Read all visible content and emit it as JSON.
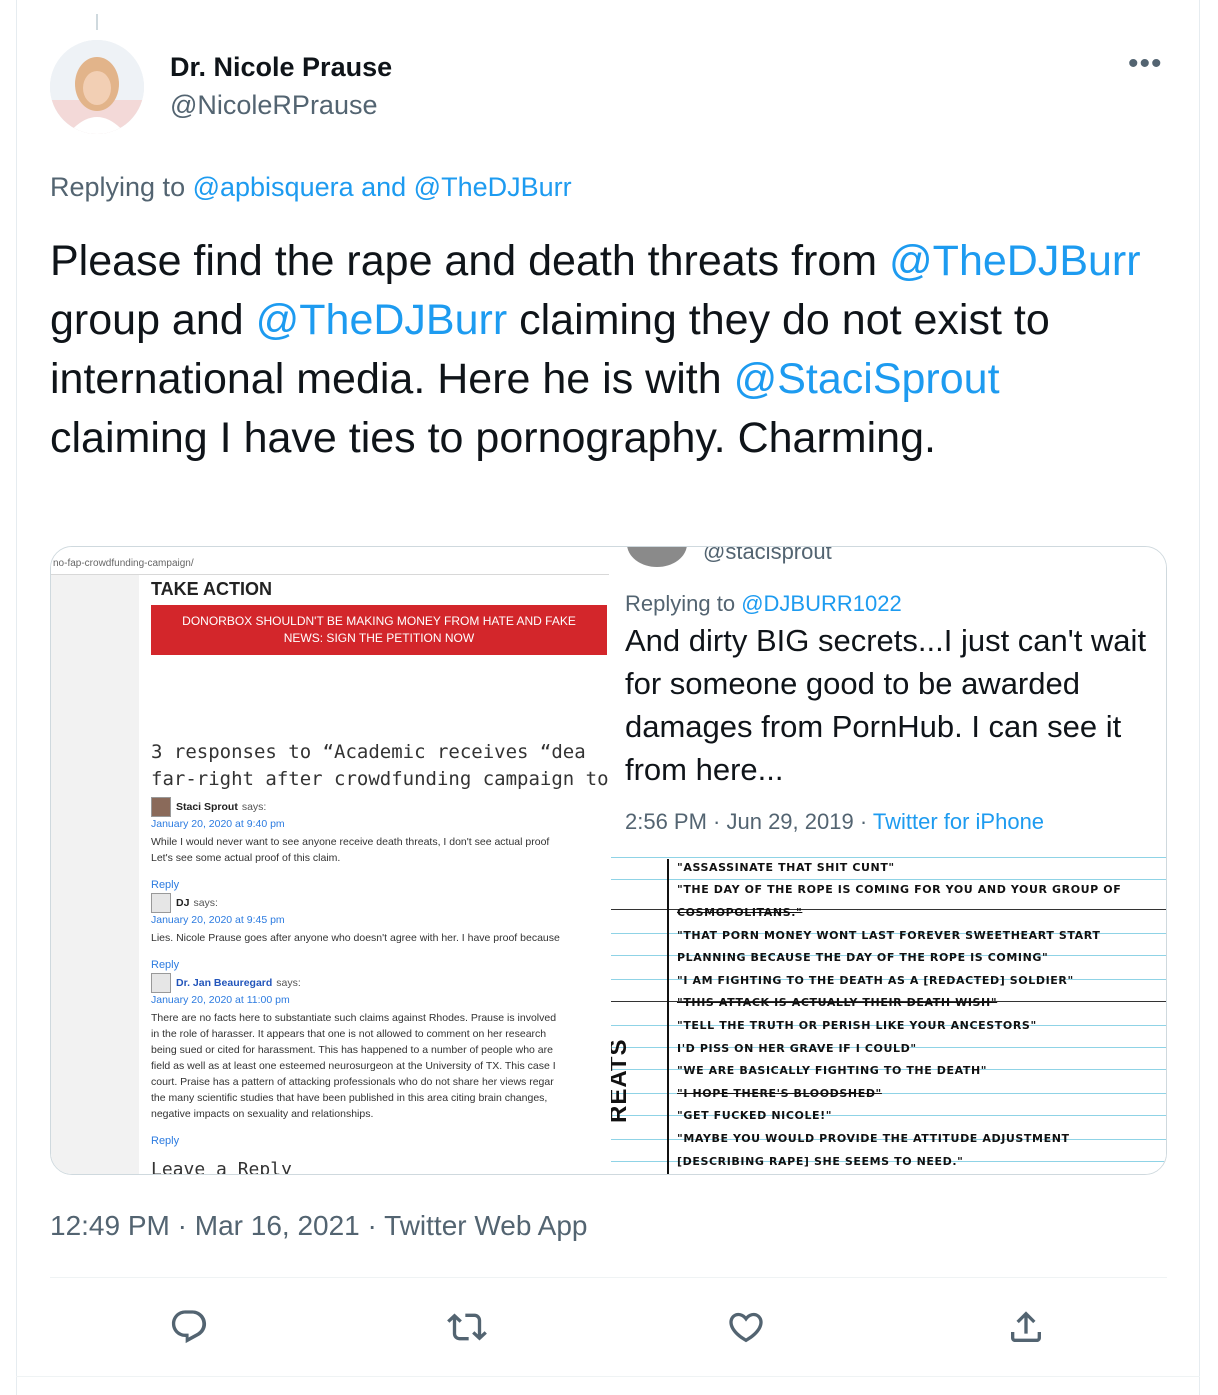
{
  "author": {
    "name": "Dr. Nicole Prause",
    "handle": "@NicoleRPrause",
    "avatar_caption": "Nicole Prause"
  },
  "more_label": "•••",
  "replying": {
    "prefix": "Replying to ",
    "to_1": "@apbisquera",
    "joiner": " and ",
    "to_2": "@TheDJBurr"
  },
  "tweet": {
    "p1": "Please find the rape and death threats from ",
    "m1": "@TheDJBurr",
    "p2": " group and ",
    "m2": "@TheDJBurr",
    "p3": " claiming they do not exist to international media. Here he is with ",
    "m3": "@StaciSprout",
    "p4": " claiming I have ties to pornography. Charming."
  },
  "left_image": {
    "url": "no-fap-crowdfunding-campaign/",
    "take_action": "TAKE ACTION",
    "banner_line1": "DONORBOX SHOULDN'T BE MAKING MONEY FROM HATE AND FAKE",
    "banner_line2": "NEWS: SIGN THE PETITION NOW",
    "responses_line1": "3 responses to “Academic receives “dea",
    "responses_line2": "far-right after crowdfunding campaign to su",
    "comments": [
      {
        "name": "Staci Sprout",
        "says": "says:",
        "date": "January 20, 2020 at 9:40 pm",
        "lines": [
          "While I would never want to see anyone receive death threats, I don't see actual proof",
          "Let's see some actual proof of this claim."
        ]
      },
      {
        "name": "DJ",
        "says": "says:",
        "date": "January 20, 2020 at 9:45 pm",
        "lines": [
          "Lies. Nicole Prause goes after anyone who doesn't agree with her. I have proof because"
        ]
      },
      {
        "name": "Dr. Jan Beauregard",
        "says": "says:",
        "date": "January 20, 2020 at 11:00 pm",
        "lines": [
          "There are no facts here to substantiate such claims against Rhodes. Prause is involved",
          "in the role of harasser. It appears that one is not allowed to comment on her research",
          "being sued or cited for harassment. This has happened to a number of people who are",
          "field as well as at least one esteemed neurosurgeon at the University of TX. This case I",
          "court. Praise has a pattern of attacking professionals who do not share her views regar",
          "the many scientific studies that have been published in this area citing brain changes,",
          "negative impacts on sexuality and relationships."
        ]
      }
    ],
    "reply_label": "Reply",
    "leave_reply": "Leave a Reply"
  },
  "right_image": {
    "handle": "@stacisprout",
    "replying_prefix": "Replying to ",
    "replying_to": "@DJBURR1022",
    "text": "And dirty BIG secrets...I just can't wait for someone good to be awarded damages from PornHub. I can see it from here...",
    "meta": "2:56 PM · Jun 29, 2019 · ",
    "app": "Twitter for iPhone",
    "threats_word": "REATS",
    "threats": [
      "\"ASSASSINATE THAT SHIT CUNT\"",
      "\"THE DAY OF THE ROPE IS COMING FOR YOU AND YOUR GROUP OF",
      "COSMOPOLITANS.\"",
      "\"THAT PORN MONEY WONT LAST FOREVER SWEETHEART START",
      "PLANNING BECAUSE THE DAY OF THE ROPE IS COMING\"",
      "\"I AM FIGHTING TO THE DEATH AS A [REDACTED] SOLDIER\"",
      "\"THIS ATTACK IS ACTUALLY THEIR DEATH WISH\"",
      "\"TELL THE TRUTH OR PERISH LIKE YOUR ANCESTORS\"",
      "I'D PISS ON HER GRAVE IF I COULD\"",
      "\"WE ARE BASICALLY FIGHTING TO THE DEATH\"",
      "\"I HOPE THERE'S BLOODSHED\"",
      "\"GET FUCKED NICOLE!\"",
      "\"MAYBE YOU WOULD PROVIDE THE ATTITUDE ADJUSTMENT",
      "[DESCRIBING RAPE] SHE SEEMS TO NEED.\""
    ]
  },
  "timestamp": {
    "time": "12:49 PM",
    "sep1": " · ",
    "date": "Mar 16, 2021",
    "sep2": " · ",
    "app": "Twitter Web App"
  },
  "actions": [
    "reply-icon",
    "retweet-icon",
    "like-icon",
    "share-icon"
  ],
  "colors": {
    "link": "#1d9bf0",
    "secondary": "#536471",
    "banner_red": "#d3262b"
  }
}
